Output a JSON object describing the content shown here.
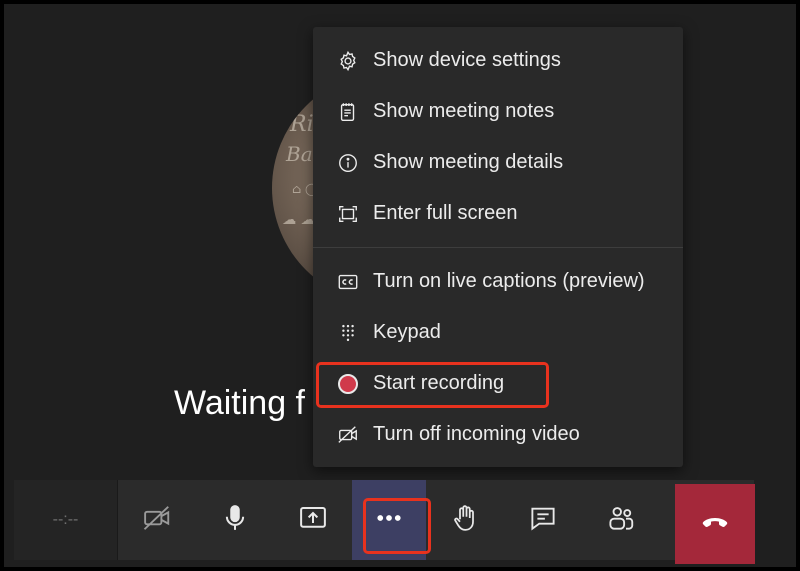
{
  "stage": {
    "waiting_text": "Waiting f"
  },
  "menu": {
    "items": [
      {
        "label": "Show device settings",
        "icon": "gear-icon"
      },
      {
        "label": "Show meeting notes",
        "icon": "notes-icon"
      },
      {
        "label": "Show meeting details",
        "icon": "info-icon"
      },
      {
        "label": "Enter full screen",
        "icon": "fullscreen-icon"
      },
      {
        "label": "Turn on live captions (preview)",
        "icon": "captions-icon"
      },
      {
        "label": "Keypad",
        "icon": "keypad-icon"
      },
      {
        "label": "Start recording",
        "icon": "record-icon"
      },
      {
        "label": "Turn off incoming video",
        "icon": "video-off-icon"
      }
    ]
  },
  "toolbar": {
    "timer": "--:--",
    "buttons": [
      "camera-off-icon",
      "microphone-icon",
      "share-screen-icon",
      "more-options-icon",
      "raise-hand-icon",
      "chat-icon",
      "participants-icon",
      "hang-up-icon"
    ]
  },
  "colors": {
    "highlight": "#e8321e",
    "hangup": "#a4283a",
    "active_button": "#3d3f63",
    "record_dot": "#d03a4b"
  }
}
